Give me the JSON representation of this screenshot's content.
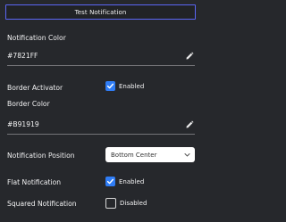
{
  "test_button": {
    "label": "Test Notification"
  },
  "notification_color": {
    "label": "Notification Color",
    "value": "#7821FF"
  },
  "border_activator": {
    "label": "Border Activator",
    "checked": true,
    "state_label": "Enabled"
  },
  "border_color": {
    "label": "Border Color",
    "value": "#B91919"
  },
  "notification_position": {
    "label": "Notification Position",
    "selected": "Bottom Center"
  },
  "flat_notification": {
    "label": "Flat Notification",
    "checked": true,
    "state_label": "Enabled"
  },
  "squared_notification": {
    "label": "Squared Notification",
    "checked": false,
    "state_label": "Disabled"
  },
  "colors": {
    "accent_border": "#5b66f5",
    "checkbox_on": "#2f7df6",
    "background": "#26282c"
  },
  "icons": {
    "edit": "pencil-icon",
    "check": "checkmark-icon",
    "dropdown": "chevron-down-icon"
  }
}
